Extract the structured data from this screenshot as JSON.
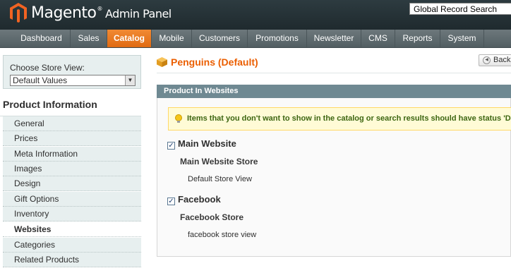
{
  "header": {
    "logo_main": "Magento",
    "logo_reg": "®",
    "logo_sub": "Admin Panel",
    "search_value": "Global Record Search"
  },
  "nav": {
    "items": [
      "Dashboard",
      "Sales",
      "Catalog",
      "Mobile",
      "Customers",
      "Promotions",
      "Newsletter",
      "CMS",
      "Reports",
      "System"
    ],
    "active": "Catalog"
  },
  "store_switcher": {
    "label": "Choose Store View:",
    "selected": "Default Values"
  },
  "sidebar": {
    "title": "Product Information",
    "tabs": [
      "General",
      "Prices",
      "Meta Information",
      "Images",
      "Design",
      "Gift Options",
      "Inventory",
      "Websites",
      "Categories",
      "Related Products"
    ],
    "active": "Websites"
  },
  "page": {
    "title": "Penguins (Default)",
    "back_label": "Back"
  },
  "websites_section": {
    "header": "Product In Websites",
    "notice": "Items that you don't want to show in the catalog or search results should have status 'Disabled' in the desired store.",
    "websites": [
      {
        "name": "Main Website",
        "checked": true,
        "store": "Main Website Store",
        "view": "Default Store View"
      },
      {
        "name": "Facebook",
        "checked": true,
        "store": "Facebook Store",
        "view": "facebook store view"
      }
    ]
  },
  "colors": {
    "accent": "#eb5e00",
    "nav_active": "#e8761f",
    "section_header": "#6f8992",
    "notice_bg": "#fffbd6"
  }
}
